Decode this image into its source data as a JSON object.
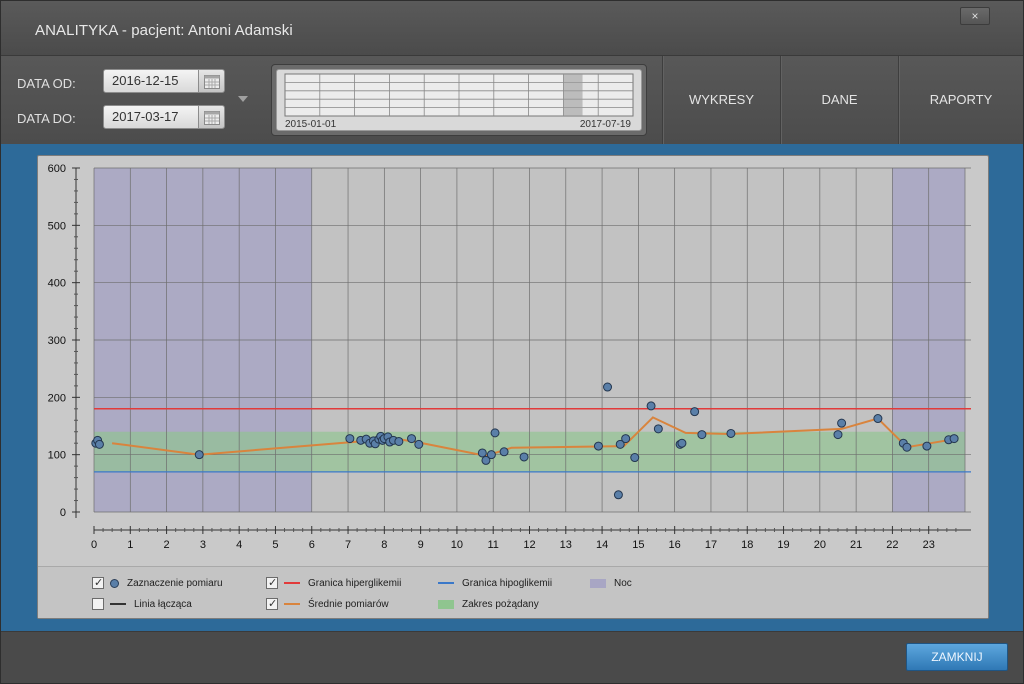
{
  "window": {
    "title": "ANALITYKA - pacjent: Antoni Adamski",
    "close_label": "×"
  },
  "filters": {
    "date_from_label": "DATA OD:",
    "date_from_value": "2016-12-15",
    "date_to_label": "DATA DO:",
    "date_to_value": "2017-03-17"
  },
  "range_navigator": {
    "start_label": "2015-01-01",
    "end_label": "2017-07-19",
    "selection_from": 0.8,
    "selection_to": 0.855
  },
  "nav": {
    "charts": "WYKRESY",
    "data": "DANE",
    "reports": "RAPORTY"
  },
  "legend": {
    "measurement_marker": {
      "label": "Zaznaczenie pomiaru",
      "checked": true
    },
    "connecting_line": {
      "label": "Linia łącząca",
      "checked": false
    },
    "hyper_limit": {
      "label": "Granica hiperglikemii",
      "checked": true
    },
    "avg_measurements": {
      "label": "Średnie pomiarów",
      "checked": true
    },
    "hypo_limit": {
      "label": "Granica hipoglikemii"
    },
    "desired_range": {
      "label": "Zakres pożądany"
    },
    "night": {
      "label": "Noc"
    }
  },
  "footer": {
    "close_button": "ZAMKNIJ"
  },
  "colors": {
    "hyper": "#e23a3a",
    "hypo": "#3a78c9",
    "average": "#d9843d",
    "desired": "#8fc58f",
    "night": "#a8a6c4",
    "point": "#5a7fa8"
  },
  "chart_data": {
    "type": "scatter",
    "xlim": [
      0,
      24
    ],
    "ylim": [
      0,
      600
    ],
    "x_ticks": [
      0,
      1,
      2,
      3,
      4,
      5,
      6,
      7,
      8,
      9,
      10,
      11,
      12,
      13,
      14,
      15,
      16,
      17,
      18,
      19,
      20,
      21,
      22,
      23
    ],
    "y_ticks": [
      0,
      100,
      200,
      300,
      400,
      500,
      600
    ],
    "hyperglycemia_limit": 180,
    "hypoglycemia_limit": 70,
    "desired_range": [
      70,
      140
    ],
    "night_ranges": [
      [
        0,
        6
      ],
      [
        22,
        24
      ]
    ],
    "grid": true,
    "measurements": [
      [
        0.05,
        120
      ],
      [
        0.1,
        125
      ],
      [
        0.15,
        118
      ],
      [
        2.9,
        100
      ],
      [
        7.05,
        128
      ],
      [
        7.35,
        125
      ],
      [
        7.5,
        127
      ],
      [
        7.6,
        120
      ],
      [
        7.7,
        124
      ],
      [
        7.75,
        119
      ],
      [
        7.85,
        127
      ],
      [
        7.9,
        132
      ],
      [
        7.95,
        125
      ],
      [
        8.0,
        128
      ],
      [
        8.1,
        131
      ],
      [
        8.15,
        122
      ],
      [
        8.25,
        125
      ],
      [
        8.4,
        123
      ],
      [
        8.75,
        128
      ],
      [
        8.95,
        118
      ],
      [
        10.7,
        103
      ],
      [
        10.8,
        90
      ],
      [
        10.95,
        100
      ],
      [
        11.05,
        138
      ],
      [
        11.3,
        105
      ],
      [
        11.85,
        96
      ],
      [
        13.9,
        115
      ],
      [
        14.15,
        218
      ],
      [
        14.45,
        30
      ],
      [
        14.5,
        118
      ],
      [
        14.65,
        128
      ],
      [
        14.9,
        95
      ],
      [
        15.35,
        185
      ],
      [
        15.55,
        145
      ],
      [
        16.15,
        118
      ],
      [
        16.2,
        120
      ],
      [
        16.55,
        175
      ],
      [
        16.75,
        135
      ],
      [
        17.55,
        137
      ],
      [
        20.5,
        135
      ],
      [
        20.6,
        155
      ],
      [
        21.6,
        163
      ],
      [
        22.3,
        120
      ],
      [
        22.4,
        113
      ],
      [
        22.95,
        115
      ],
      [
        23.55,
        126
      ],
      [
        23.7,
        128
      ]
    ],
    "average_series": [
      [
        0.5,
        120
      ],
      [
        2.9,
        100
      ],
      [
        7.1,
        122
      ],
      [
        8.3,
        128
      ],
      [
        8.9,
        122
      ],
      [
        10.8,
        98
      ],
      [
        11.5,
        112
      ],
      [
        14.6,
        115
      ],
      [
        15.4,
        165
      ],
      [
        16.3,
        138
      ],
      [
        17.5,
        136
      ],
      [
        20.6,
        145
      ],
      [
        21.6,
        163
      ],
      [
        22.4,
        113
      ],
      [
        23.7,
        127
      ]
    ]
  }
}
